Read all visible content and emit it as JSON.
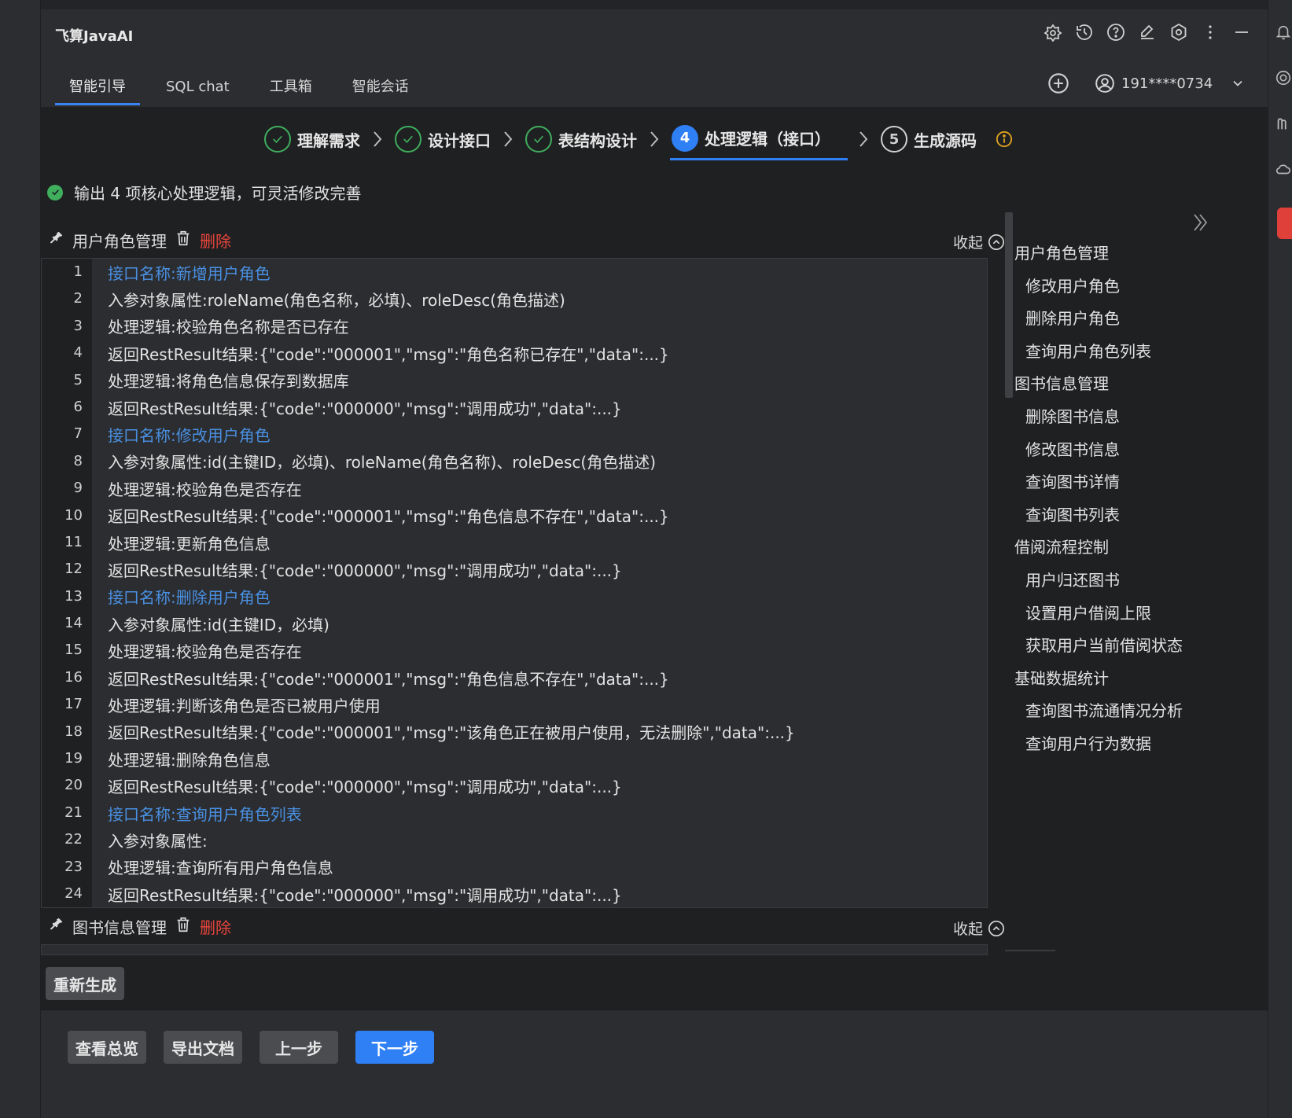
{
  "app": {
    "title": "飞算JavaAI"
  },
  "tabs": [
    {
      "label": "智能引导"
    },
    {
      "label": "SQL chat"
    },
    {
      "label": "工具箱"
    },
    {
      "label": "智能会话"
    }
  ],
  "user": {
    "account": "191****0734"
  },
  "steps": [
    {
      "label": "理解需求",
      "status": "done"
    },
    {
      "label": "设计接口",
      "status": "done"
    },
    {
      "label": "表结构设计",
      "status": "done"
    },
    {
      "label": "处理逻辑（接口）",
      "number": "4",
      "status": "active"
    },
    {
      "label": "生成源码",
      "number": "5",
      "status": "pending"
    }
  ],
  "notice": "输出 4 项核心处理逻辑，可灵活修改完善",
  "sections": [
    {
      "title": "用户角色管理",
      "delete_label": "删除",
      "collapse_label": "收起",
      "lines": [
        {
          "num": "1",
          "text": "接口名称:新增用户角色",
          "kind": "iface"
        },
        {
          "num": "2",
          "text": "入参对象属性:roleName(角色名称，必填)、roleDesc(角色描述)",
          "kind": "text"
        },
        {
          "num": "3",
          "text": "处理逻辑:校验角色名称是否已存在",
          "kind": "text"
        },
        {
          "num": "4",
          "text": "返回RestResult结果:{\"code\":\"000001\",\"msg\":\"角色名称已存在\",\"data\":...}",
          "kind": "text"
        },
        {
          "num": "5",
          "text": "处理逻辑:将角色信息保存到数据库",
          "kind": "text"
        },
        {
          "num": "6",
          "text": "返回RestResult结果:{\"code\":\"000000\",\"msg\":\"调用成功\",\"data\":...}",
          "kind": "text"
        },
        {
          "num": "7",
          "text": "接口名称:修改用户角色",
          "kind": "iface"
        },
        {
          "num": "8",
          "text": "入参对象属性:id(主键ID，必填)、roleName(角色名称)、roleDesc(角色描述)",
          "kind": "text"
        },
        {
          "num": "9",
          "text": "处理逻辑:校验角色是否存在",
          "kind": "text"
        },
        {
          "num": "10",
          "text": "返回RestResult结果:{\"code\":\"000001\",\"msg\":\"角色信息不存在\",\"data\":...}",
          "kind": "text"
        },
        {
          "num": "11",
          "text": "处理逻辑:更新角色信息",
          "kind": "text"
        },
        {
          "num": "12",
          "text": "返回RestResult结果:{\"code\":\"000000\",\"msg\":\"调用成功\",\"data\":...}",
          "kind": "text"
        },
        {
          "num": "13",
          "text": "接口名称:删除用户角色",
          "kind": "iface"
        },
        {
          "num": "14",
          "text": "入参对象属性:id(主键ID，必填)",
          "kind": "text"
        },
        {
          "num": "15",
          "text": "处理逻辑:校验角色是否存在",
          "kind": "text"
        },
        {
          "num": "16",
          "text": "返回RestResult结果:{\"code\":\"000001\",\"msg\":\"角色信息不存在\",\"data\":...}",
          "kind": "text"
        },
        {
          "num": "17",
          "text": "处理逻辑:判断该角色是否已被用户使用",
          "kind": "text"
        },
        {
          "num": "18",
          "text": "返回RestResult结果:{\"code\":\"000001\",\"msg\":\"该角色正在被用户使用，无法删除\",\"data\":...}",
          "kind": "text"
        },
        {
          "num": "19",
          "text": "处理逻辑:删除角色信息",
          "kind": "text"
        },
        {
          "num": "20",
          "text": "返回RestResult结果:{\"code\":\"000000\",\"msg\":\"调用成功\",\"data\":...}",
          "kind": "text"
        },
        {
          "num": "21",
          "text": "接口名称:查询用户角色列表",
          "kind": "iface"
        },
        {
          "num": "22",
          "text": "入参对象属性:",
          "kind": "text"
        },
        {
          "num": "23",
          "text": "处理逻辑:查询所有用户角色信息",
          "kind": "text"
        },
        {
          "num": "24",
          "text": "返回RestResult结果:{\"code\":\"000000\",\"msg\":\"调用成功\",\"data\":...}",
          "kind": "text"
        }
      ]
    },
    {
      "title": "图书信息管理",
      "delete_label": "删除",
      "collapse_label": "收起",
      "lines": []
    }
  ],
  "toc": [
    {
      "label": "用户角色管理",
      "level": 1
    },
    {
      "label": "修改用户角色",
      "level": 2
    },
    {
      "label": "删除用户角色",
      "level": 2
    },
    {
      "label": "查询用户角色列表",
      "level": 2
    },
    {
      "label": "图书信息管理",
      "level": 1
    },
    {
      "label": "删除图书信息",
      "level": 2
    },
    {
      "label": "修改图书信息",
      "level": 2
    },
    {
      "label": "查询图书详情",
      "level": 2
    },
    {
      "label": "查询图书列表",
      "level": 2
    },
    {
      "label": "借阅流程控制",
      "level": 1
    },
    {
      "label": "用户归还图书",
      "level": 2
    },
    {
      "label": "设置用户借阅上限",
      "level": 2
    },
    {
      "label": "获取用户当前借阅状态",
      "level": 2
    },
    {
      "label": "基础数据统计",
      "level": 1
    },
    {
      "label": "查询图书流通情况分析",
      "level": 2
    },
    {
      "label": "查询用户行为数据",
      "level": 2
    }
  ],
  "buttons": {
    "regenerate": "重新生成",
    "overview": "查看总览",
    "export": "导出文档",
    "prev": "上一步",
    "next": "下一步"
  },
  "colors": {
    "accent": "#2f7ff5",
    "success": "#3fae5d",
    "danger": "#e8453c",
    "link": "#4a90e2",
    "warning": "#e0a320"
  },
  "icons": {
    "header": [
      "ai-logo-icon",
      "history-icon",
      "help-icon",
      "edit-icon",
      "settings-icon",
      "more-icon",
      "minimize-icon"
    ],
    "side": [
      "bell-icon",
      "ai-assistant-icon",
      "plugin-icon",
      "cloud-icon"
    ]
  }
}
